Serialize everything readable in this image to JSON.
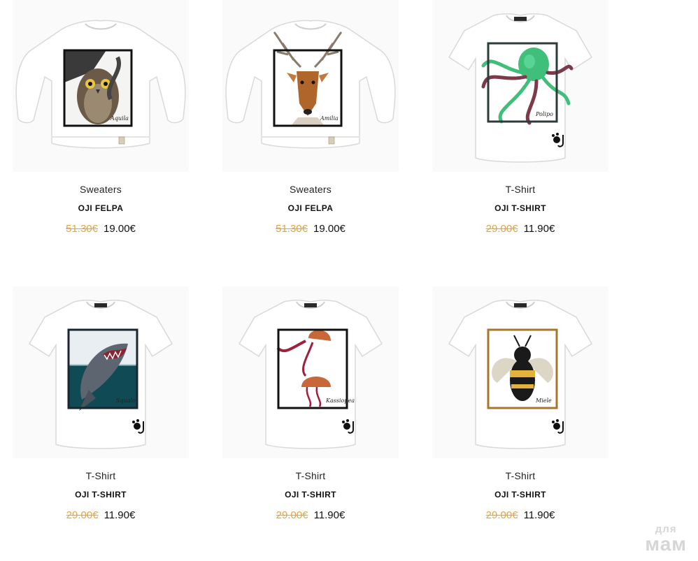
{
  "products": [
    {
      "category": "Sweaters",
      "name": "OJI FELPA",
      "old_price": "51.30€",
      "new_price": "19.00€",
      "garment": "sweater",
      "print": "owl-eagle",
      "frame": "#111111",
      "signature": "Aquila"
    },
    {
      "category": "Sweaters",
      "name": "OJI FELPA",
      "old_price": "51.30€",
      "new_price": "19.00€",
      "garment": "sweater",
      "print": "deer",
      "frame": "#111111",
      "signature": "Amilia"
    },
    {
      "category": "T-Shirt",
      "name": "OJI T-SHIRT",
      "old_price": "29.00€",
      "new_price": "11.90€",
      "garment": "tshirt",
      "print": "octopus",
      "frame": "#2f3a3a",
      "signature": "Polipo"
    },
    {
      "category": "T-Shirt",
      "name": "OJI T-SHIRT",
      "old_price": "29.00€",
      "new_price": "11.90€",
      "garment": "tshirt",
      "print": "shark",
      "frame": "#1a2530",
      "signature": "Squalo"
    },
    {
      "category": "T-Shirt",
      "name": "OJI T-SHIRT",
      "old_price": "29.00€",
      "new_price": "11.90€",
      "garment": "tshirt",
      "print": "jellyfish",
      "frame": "#111111",
      "signature": "Kassiopea"
    },
    {
      "category": "T-Shirt",
      "name": "OJI T-SHIRT",
      "old_price": "29.00€",
      "new_price": "11.90€",
      "garment": "tshirt",
      "print": "bee",
      "frame": "#a8752f",
      "signature": "Miele"
    }
  ],
  "watermark": {
    "line1": "для",
    "line2": "мам"
  },
  "colors": {
    "old_price": "#e8a23d",
    "new_price": "#111111",
    "tile_bg": "#fafafa"
  }
}
